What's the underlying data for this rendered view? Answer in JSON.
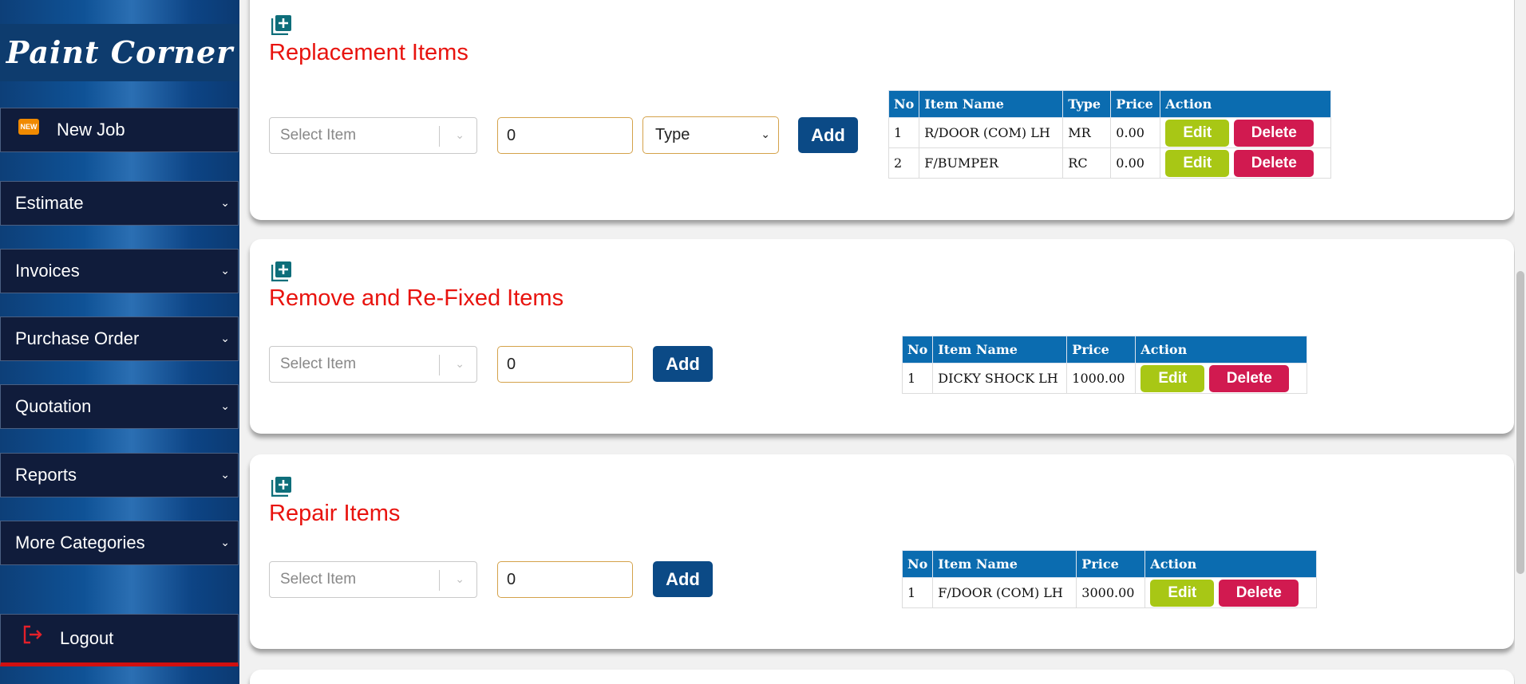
{
  "sidebar": {
    "brand": "Paint Corner",
    "new_badge": "NEW",
    "new_job": "New Job",
    "items": [
      {
        "label": "Estimate"
      },
      {
        "label": "Invoices"
      },
      {
        "label": "Purchase Order"
      },
      {
        "label": "Quotation"
      },
      {
        "label": "Reports"
      },
      {
        "label": "More Categories"
      }
    ],
    "logout": "Logout"
  },
  "sections": {
    "replacement": {
      "title": "Replacement Items",
      "select_placeholder": "Select Item",
      "qty_value": "0",
      "type_label": "Type",
      "add_label": "Add",
      "headers": [
        "No",
        "Item Name",
        "Type",
        "Price",
        "Action"
      ],
      "rows": [
        {
          "no": "1",
          "name": "R/DOOR (COM) LH",
          "type": "MR",
          "price": "0.00"
        },
        {
          "no": "2",
          "name": "F/BUMPER",
          "type": "RC",
          "price": "0.00"
        }
      ]
    },
    "remove_refix": {
      "title": "Remove and Re-Fixed Items",
      "select_placeholder": "Select Item",
      "qty_value": "0",
      "add_label": "Add",
      "headers": [
        "No",
        "Item Name",
        "Price",
        "Action"
      ],
      "rows": [
        {
          "no": "1",
          "name": "DICKY SHOCK LH",
          "price": "1000.00"
        }
      ]
    },
    "repair": {
      "title": "Repair Items",
      "select_placeholder": "Select Item",
      "qty_value": "0",
      "add_label": "Add",
      "headers": [
        "No",
        "Item Name",
        "Price",
        "Action"
      ],
      "rows": [
        {
          "no": "1",
          "name": "F/DOOR (COM) LH",
          "price": "3000.00"
        }
      ]
    }
  },
  "buttons": {
    "edit": "Edit",
    "delete": "Delete"
  },
  "colors": {
    "title_red": "#e8130e",
    "header_blue": "#0b6cb0",
    "add_blue": "#0b4a86",
    "edit_green": "#a8c715",
    "delete_red": "#d11a50",
    "nav_dark": "#101c3b",
    "icon_teal": "#0e6e7a"
  }
}
